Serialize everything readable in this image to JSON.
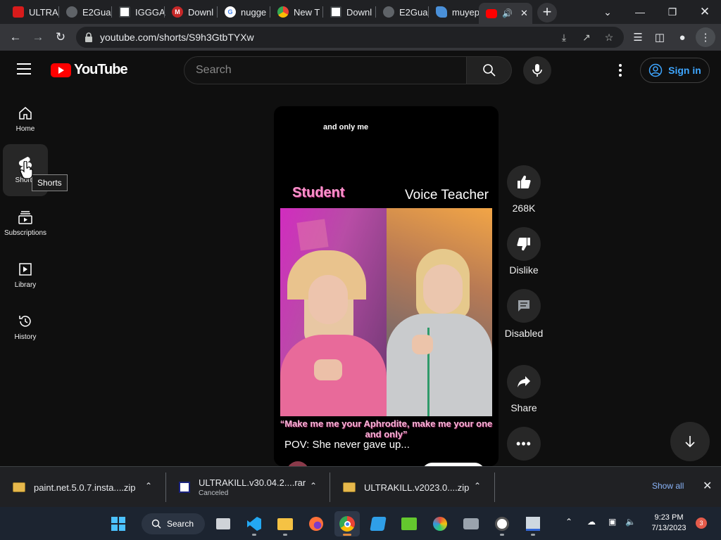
{
  "browser": {
    "tabs": [
      {
        "title": "ULTRA",
        "favicon_color": "#d81b1b",
        "favicon": "",
        "favicon_icon": "app-icon"
      },
      {
        "title": "E2Gua",
        "favicon_color": "#5f6368",
        "favicon": "",
        "favicon_icon": "globe-icon"
      },
      {
        "title": "IGGGA",
        "favicon_color": "#3c4043",
        "favicon": "",
        "favicon_icon": "site-icon"
      },
      {
        "title": "Downl",
        "favicon_color": "#c62828",
        "favicon": "M",
        "favicon_icon": "mega-icon"
      },
      {
        "title": "nugge",
        "favicon_color": "#ffffff",
        "favicon": "G",
        "favicon_icon": "google-icon"
      },
      {
        "title": "New T",
        "favicon_color": "#5f6368",
        "favicon": "",
        "favicon_icon": "chrome-icon"
      },
      {
        "title": "Downl",
        "favicon_color": "#3c4043",
        "favicon": "",
        "favicon_icon": "site-icon"
      },
      {
        "title": "E2Gua",
        "favicon_color": "#5f6368",
        "favicon": "",
        "favicon_icon": "globe-icon"
      },
      {
        "title": "muyep",
        "favicon_color": "#4a90d9",
        "favicon": "",
        "favicon_icon": "site-icon"
      }
    ],
    "active_tab_audio_icon": "speaker-icon",
    "url": "youtube.com/shorts/S9h3GtbTYXw"
  },
  "youtube": {
    "logo_text": "YouTube",
    "search_placeholder": "Search",
    "sign_in_label": "Sign in",
    "sidebar": [
      {
        "label": "Home",
        "icon": "home-icon"
      },
      {
        "label": "Shorts",
        "icon": "shorts-icon"
      },
      {
        "label": "Subscriptions",
        "icon": "subscriptions-icon"
      },
      {
        "label": "Library",
        "icon": "library-icon"
      },
      {
        "label": "History",
        "icon": "history-icon"
      }
    ],
    "tooltip": "Shorts",
    "short": {
      "overlay_text": "and only me",
      "label_left": "Student",
      "label_right": "Voice Teacher",
      "caption": "“Make me me your Aphrodite, make me your one and only”",
      "title": "POV: She never gave up..."
    },
    "actions": {
      "like_count": "268K",
      "dislike_label": "Dislike",
      "comments_label": "Disabled",
      "share_label": "Share"
    }
  },
  "downloads": {
    "items": [
      {
        "name": "paint.net.5.0.7.insta....zip",
        "status": ""
      },
      {
        "name": "ULTRAKILL.v30.04.2....rar",
        "status": "Canceled"
      },
      {
        "name": "ULTRAKILL.v2023.0....zip",
        "status": ""
      }
    ],
    "show_all": "Show all"
  },
  "taskbar": {
    "search_label": "Search",
    "time": "9:23 PM",
    "date": "7/13/2023",
    "notifications": "3"
  },
  "colors": {
    "accent_red": "#ff0000",
    "link_blue": "#3ea6ff",
    "student_pink": "#f593c9"
  }
}
